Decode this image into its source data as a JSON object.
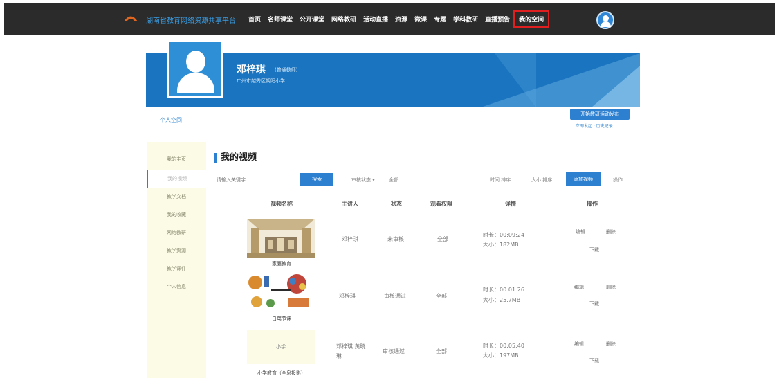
{
  "header": {
    "site_name": "湖南省教育网络资源共享平台",
    "nav": [
      "首页",
      "名师课堂",
      "公开课堂",
      "网络教研",
      "活动直播",
      "资源",
      "微课",
      "专题",
      "学科教研",
      "直播预告",
      "我的空间"
    ],
    "active_nav_index": 10
  },
  "profile": {
    "name": "邓梓琪",
    "role": "(普通教师)",
    "school": "广州市越秀区朝阳小学"
  },
  "personal_link": "个人空间",
  "publish": {
    "button": "开始教研活动发布",
    "sub": "立即发起 · 历史记录"
  },
  "sidebar": {
    "items": [
      "我的主页",
      "我的视频",
      "教学文档",
      "我的收藏",
      "网络教研",
      "教学资源",
      "教学课件",
      "个人信息"
    ],
    "active_index": 1
  },
  "main": {
    "title": "我的视频",
    "search_placeholder": "请输入关键字",
    "search_label": "搜索",
    "filter_status": "审核状态 ▾",
    "filter_all": "全部",
    "sort_time": "时间 排序",
    "sort_size": "大小 排序",
    "upload_label": "添加视频",
    "manage_label": "操作",
    "columns": [
      "视频名称",
      "主讲人",
      "状态",
      "观看权限",
      "详情",
      "操作"
    ]
  },
  "rows": [
    {
      "title": "家庭教育",
      "speaker": "邓梓琪",
      "status": "未审核",
      "permission": "全部",
      "duration": "时长：00:09:24",
      "size": "大小：182MB",
      "ops": [
        "编辑",
        "删除",
        "下载"
      ]
    },
    {
      "title": "白鹭节课",
      "speaker": "邓梓琪",
      "status": "审核通过",
      "permission": "全部",
      "duration": "时长：00:01:26",
      "size": "大小：25.7MB",
      "ops": [
        "编辑",
        "删除",
        "下载"
      ]
    },
    {
      "title": "小学教育（全息投影）",
      "thumb_text": "小学",
      "speaker": "邓梓琪 黄晓琳",
      "status": "审核通过",
      "permission": "全部",
      "duration": "时长：00:05:40",
      "size": "大小：197MB",
      "ops": [
        "编辑",
        "删除",
        "下载"
      ]
    }
  ],
  "colors": {
    "accent": "#2d7fd0",
    "topbar": "#2b2b2b",
    "sidebar_bg": "#fbfbe6",
    "banner": "#1a74bf"
  }
}
